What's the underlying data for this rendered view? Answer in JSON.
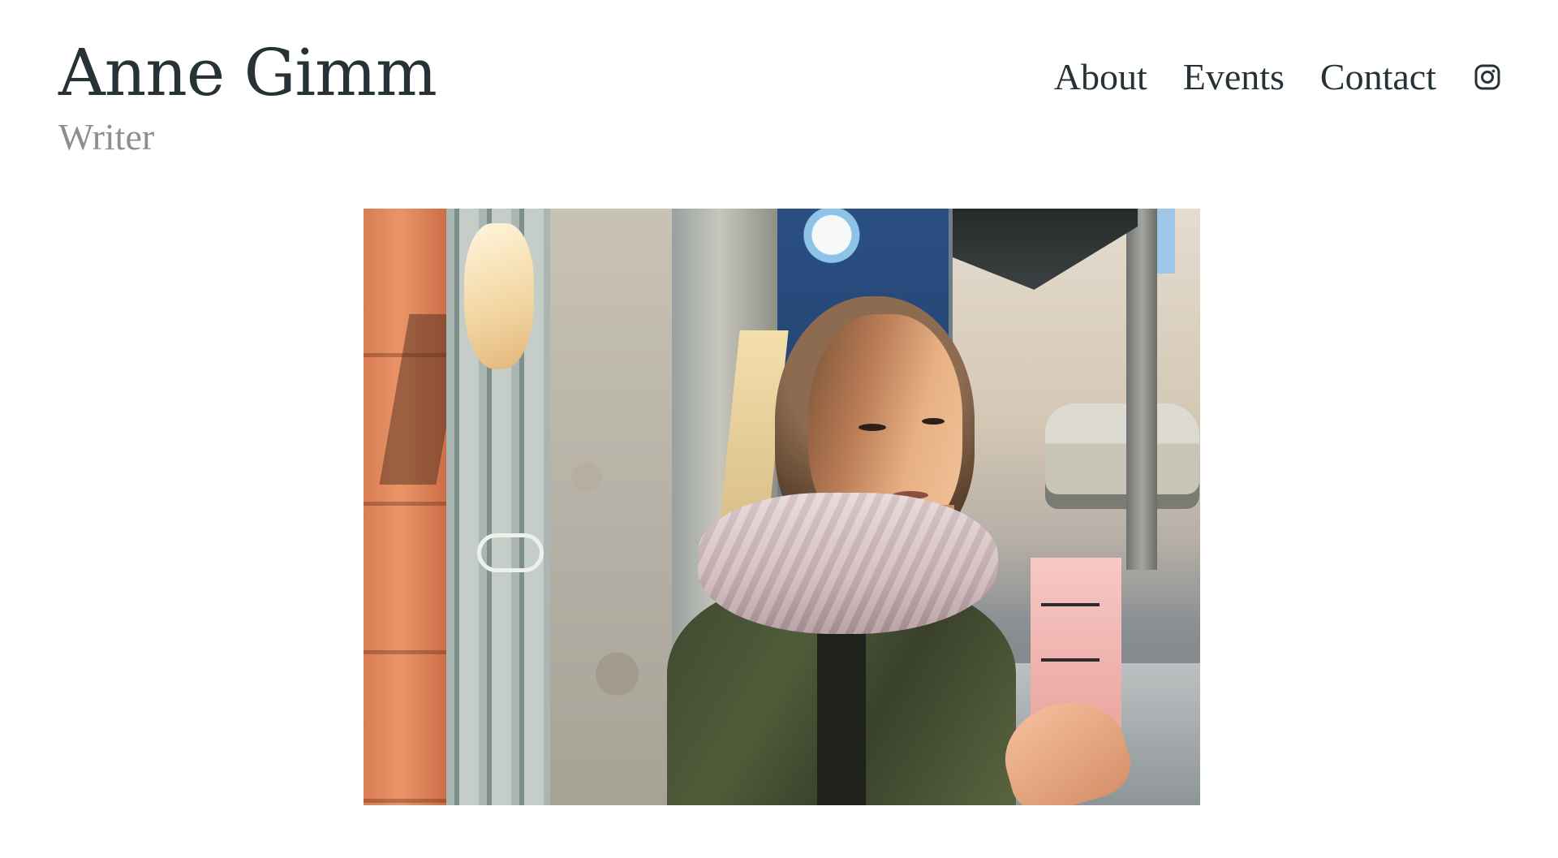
{
  "site": {
    "title": "Anne Gimm",
    "tagline": "Writer"
  },
  "nav": {
    "items": [
      {
        "label": "About"
      },
      {
        "label": "Events"
      },
      {
        "label": "Contact"
      }
    ],
    "social_icon": "instagram-icon"
  },
  "hero": {
    "image": "portrait photo"
  },
  "colors": {
    "text_primary": "#263236",
    "text_muted": "#8a8f91",
    "background": "#ffffff"
  }
}
